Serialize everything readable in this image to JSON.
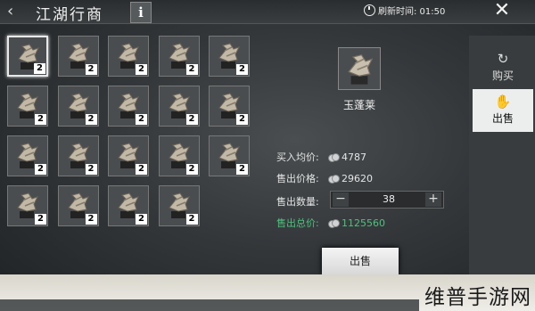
{
  "header": {
    "title": "江湖行商",
    "info_label": "i",
    "refresh_label": "刷新时间: 01:50",
    "close_label": "✕",
    "back_label": "‹"
  },
  "inventory": {
    "items": [
      {
        "count": "2"
      },
      {
        "count": "2"
      },
      {
        "count": "2"
      },
      {
        "count": "2"
      },
      {
        "count": "2"
      },
      {
        "count": "2"
      },
      {
        "count": "2"
      },
      {
        "count": "2"
      },
      {
        "count": "2"
      },
      {
        "count": "2"
      },
      {
        "count": "2"
      },
      {
        "count": "2"
      },
      {
        "count": "2"
      },
      {
        "count": "2"
      },
      {
        "count": "2"
      },
      {
        "count": "2"
      },
      {
        "count": "2"
      },
      {
        "count": "2"
      },
      {
        "count": "2"
      }
    ]
  },
  "detail": {
    "item_name": "玉蓬莱",
    "buy_avg_label": "买入均价:",
    "buy_avg_value": "4787",
    "sell_price_label": "售出价格:",
    "sell_price_value": "29620",
    "sell_qty_label": "售出数量:",
    "sell_qty_value": "38",
    "sell_total_label": "售出总价:",
    "sell_total_value": "1125560",
    "minus_label": "−",
    "plus_label": "+",
    "sell_button": "出售"
  },
  "tabs": {
    "buy": "购买",
    "sell": "出售"
  },
  "watermark": "维普手游网",
  "colors": {
    "accent_green": "#4ec27c",
    "count_badge": "#ffffff"
  }
}
